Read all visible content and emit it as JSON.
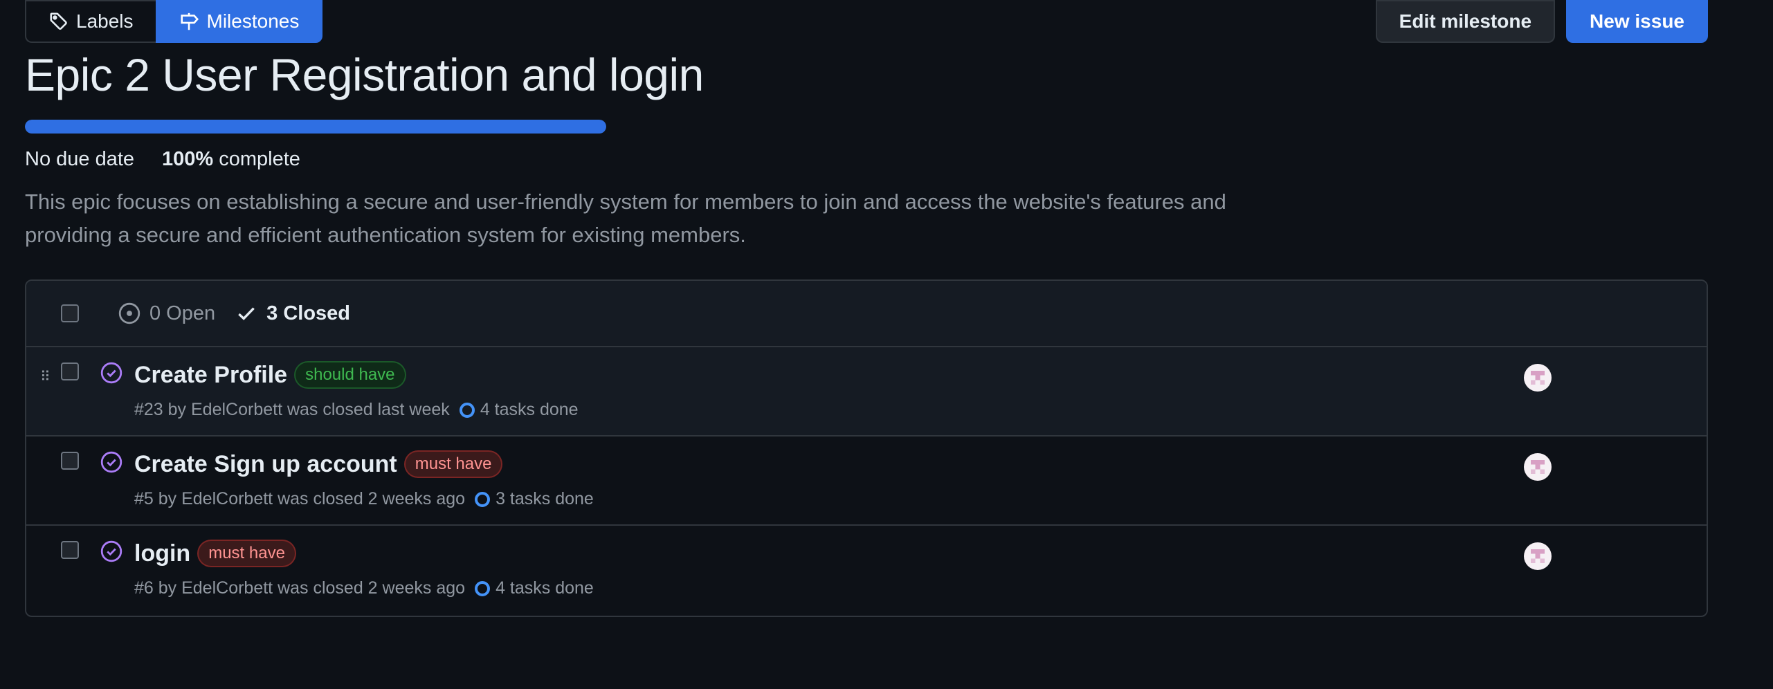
{
  "subnav": {
    "labels": "Labels",
    "milestones": "Milestones"
  },
  "actions": {
    "edit_milestone": "Edit milestone",
    "new_issue": "New issue"
  },
  "milestone": {
    "title": "Epic 2 User Registration and login",
    "due": "No due date",
    "percent": "100%",
    "percent_suffix": "complete",
    "progress_fraction": 1.0,
    "description": "This epic focuses on establishing a secure and user-friendly system for members to join and access the website's features and providing a secure and efficient authentication system for existing members."
  },
  "filters": {
    "open": "0 Open",
    "closed": "3 Closed"
  },
  "issues": [
    {
      "title": "Create Profile",
      "label": "should have",
      "meta": "#23 by EdelCorbett was closed last week",
      "tasks": "4 tasks done"
    },
    {
      "title": "Create Sign up account",
      "label": "must have",
      "meta": "#5 by EdelCorbett was closed 2 weeks ago",
      "tasks": "3 tasks done"
    },
    {
      "title": "login",
      "label": "must have",
      "meta": "#6 by EdelCorbett was closed 2 weeks ago",
      "tasks": "4 tasks done"
    }
  ],
  "colors": {
    "accent": "#2f6fe3",
    "closed_purple": "#ab7df8",
    "should_label": "#3fb950",
    "must_label": "#ff9492"
  },
  "icons": {
    "labels": "tag-icon",
    "milestones": "milestone-icon",
    "open": "issue-open-icon",
    "closed": "check-icon",
    "issue_closed": "issue-closed-icon"
  }
}
